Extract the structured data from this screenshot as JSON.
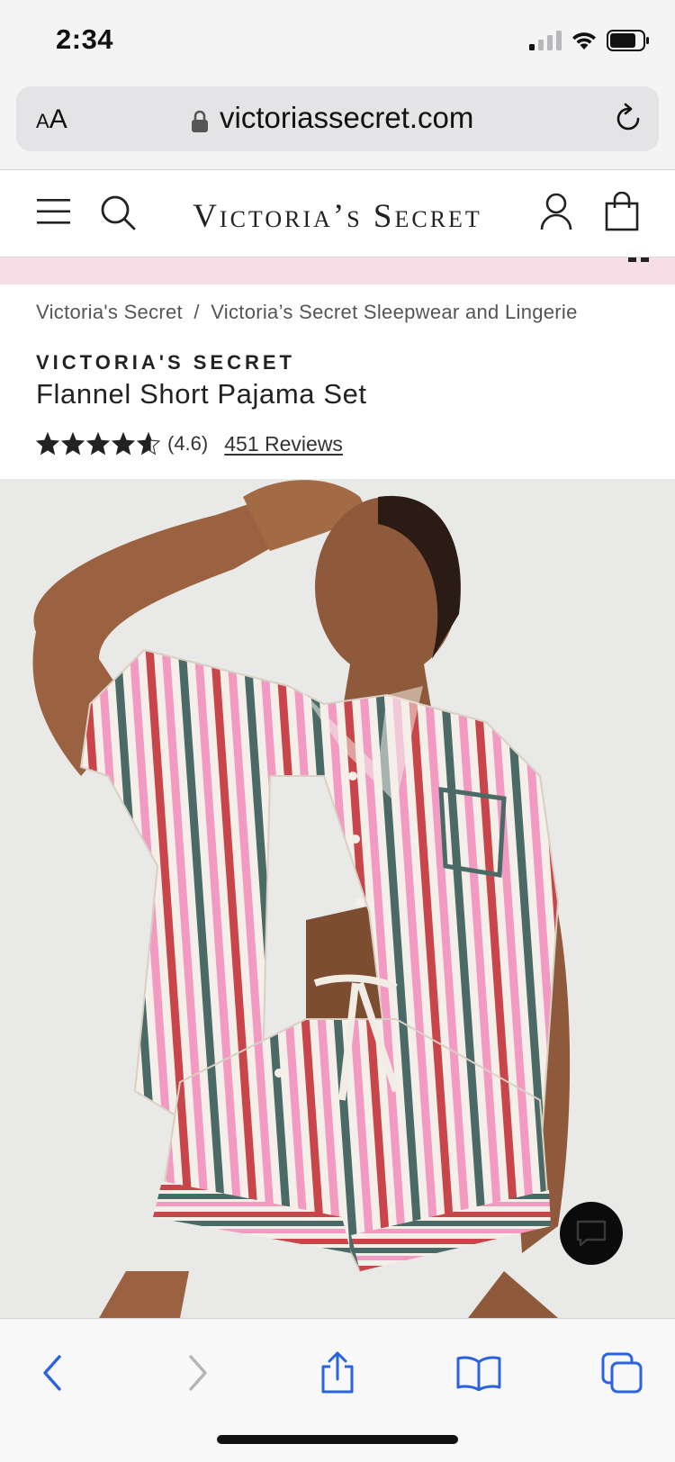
{
  "status_bar": {
    "time": "2:34"
  },
  "browser": {
    "text_size_label": "AA",
    "url": "victoriassecret.com"
  },
  "site_header": {
    "logo": "Victoria’s Secret"
  },
  "breadcrumb": {
    "items": [
      "Victoria's Secret",
      "Victoria’s Secret Sleepwear and Lingerie"
    ],
    "separator": "/"
  },
  "product": {
    "brand": "VICTORIA'S SECRET",
    "title": "Flannel Short Pajama Set",
    "rating": 4.6,
    "rating_label": "(4.6)",
    "reviews_link": "451 Reviews"
  },
  "colors": {
    "promo_strip": "#f6dde6",
    "toolbar_accent": "#2a62e0",
    "stripe_red": "#c8454a",
    "stripe_pink": "#f29ac2",
    "stripe_green": "#4b6a66"
  },
  "icons": {
    "hamburger": "menu-icon",
    "search": "search-icon",
    "account": "user-icon",
    "bag": "shopping-bag-icon",
    "chat": "chat-icon"
  }
}
